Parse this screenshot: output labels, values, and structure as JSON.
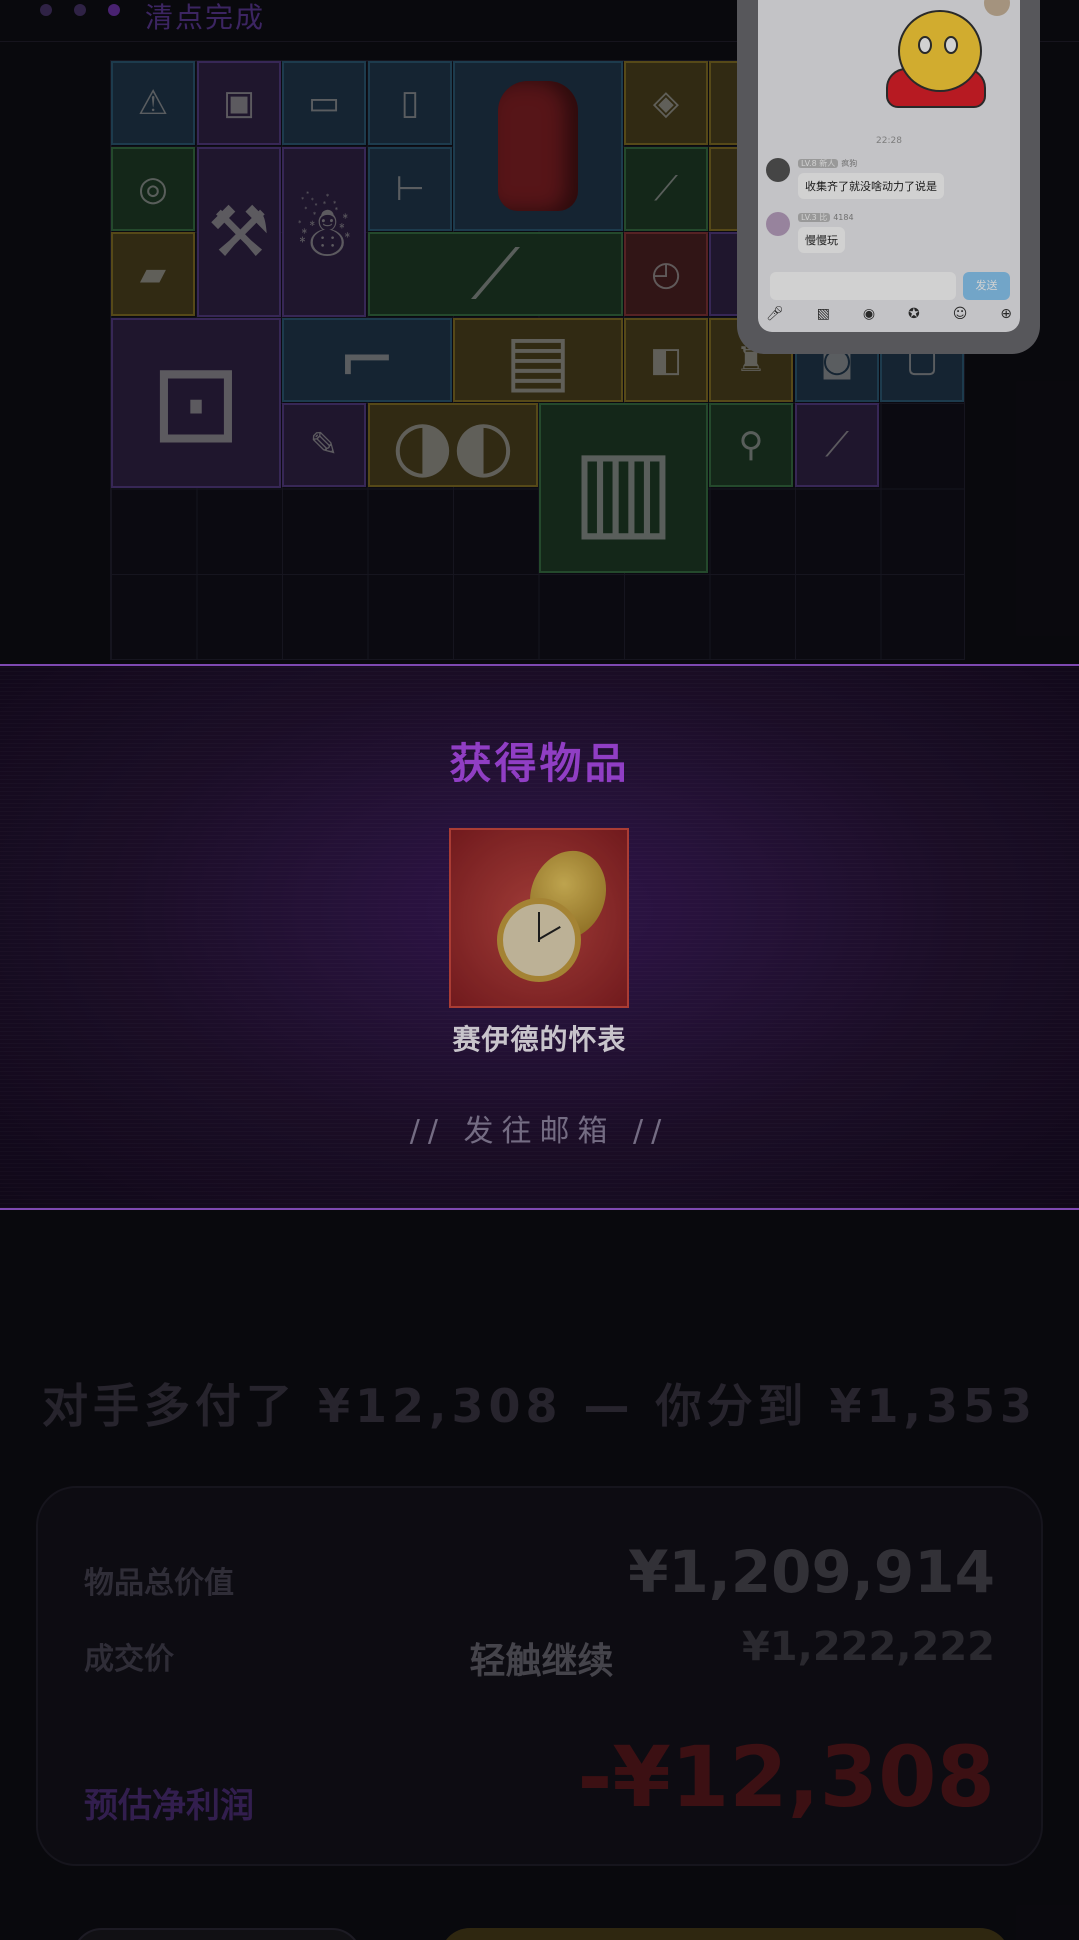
{
  "header": {
    "title": "清点完成"
  },
  "chat": {
    "time": "22:28",
    "messages": [
      {
        "tag": "LV.8 新人",
        "name": "疯狗",
        "text": "收集齐了就没啥动力了说是"
      },
      {
        "tag": "LV.3 比",
        "name": "4184",
        "text": "慢慢玩"
      }
    ],
    "send_label": "发送",
    "tools": [
      "mic-icon",
      "image-icon",
      "camera-icon",
      "sticker-icon",
      "emoji-icon",
      "plus-icon"
    ]
  },
  "reward": {
    "title": "获得物品",
    "item_name": "赛伊德的怀表",
    "mail_link": "// 发往邮箱 //"
  },
  "summary": {
    "headline": "对手多付了 ¥12,308 — 你分到 ¥1,353",
    "total_label": "物品总价值",
    "total_value": "¥1,209,914",
    "deal_label": "成交价",
    "deal_value": "¥1,222,222",
    "continue_hint": "轻触继续",
    "profit_label": "预估净利润",
    "profit_value": "-¥12,308"
  },
  "colors": {
    "accent": "#b04cf0",
    "panel_border": "#9a5ad8",
    "loss": "#4a1418"
  }
}
